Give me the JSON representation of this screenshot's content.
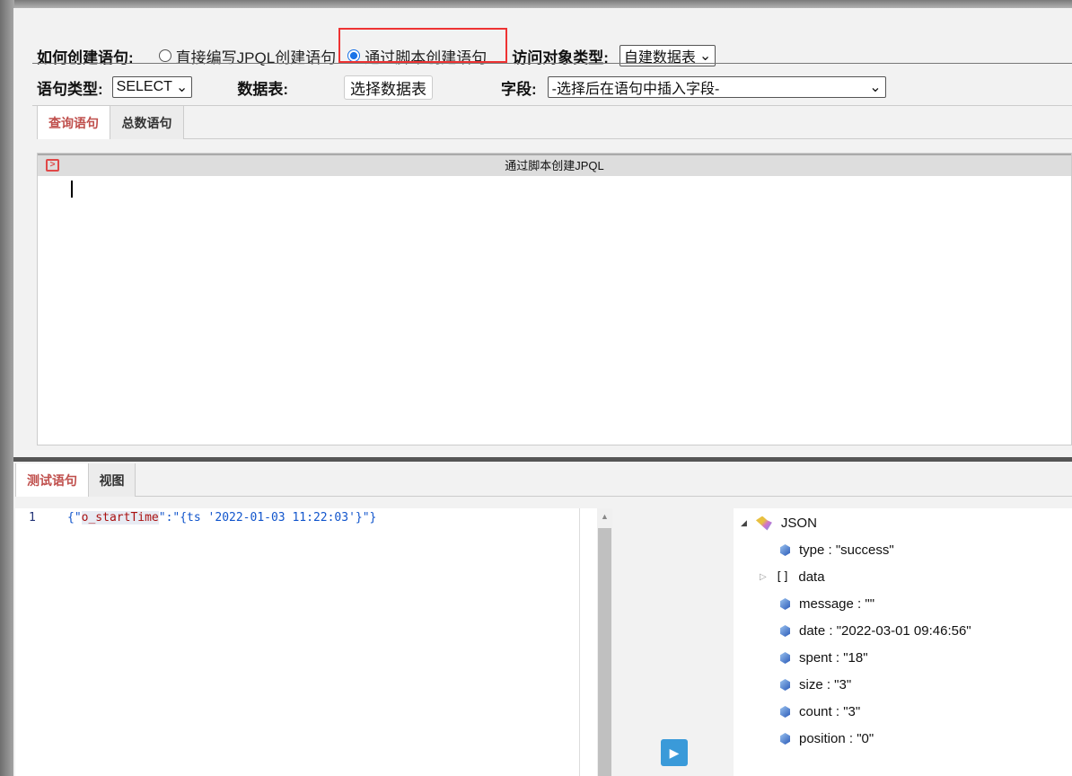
{
  "form": {
    "create_label": "如何创建语句:",
    "option_direct": "直接编写JPQL创建语句",
    "option_script": "通过脚本创建语句",
    "selected_option": "option_script",
    "target_type_label": "访问对象类型:",
    "target_type_value": "自建数据表",
    "stmt_type_label": "语句类型:",
    "stmt_type_value": "SELECT",
    "table_label": "数据表:",
    "choose_table_button": "选择数据表",
    "field_label": "字段:",
    "field_placeholder": "-选择后在语句中插入字段-"
  },
  "tabs_top": [
    {
      "label": "查询语句",
      "active": true
    },
    {
      "label": "总数语句",
      "active": false
    }
  ],
  "editor": {
    "title": "通过脚本创建JPQL"
  },
  "tabs_bottom": [
    {
      "label": "测试语句",
      "active": true
    },
    {
      "label": "视图",
      "active": false
    }
  ],
  "test_code": {
    "line_number": "1",
    "open": "{\"",
    "key": "o_startTime",
    "mid": "\":\"",
    "value": "{ts '2022-01-03 11:22:03'}",
    "close": "\"}"
  },
  "result_tree": {
    "root": "JSON",
    "items": [
      {
        "text": "type : \"success\""
      },
      {
        "text": "data",
        "array": true,
        "bracket": "[]"
      },
      {
        "text": "message : \"\""
      },
      {
        "text": "date : \"2022-03-01 09:46:56\""
      },
      {
        "text": "spent : \"18\""
      },
      {
        "text": "size : \"3\""
      },
      {
        "text": "count : \"3\""
      },
      {
        "text": "position : \"0\""
      }
    ]
  },
  "colors": {
    "accent_tab": "#c0504d",
    "highlight": "#ee3333",
    "play": "#3a9ad9"
  }
}
